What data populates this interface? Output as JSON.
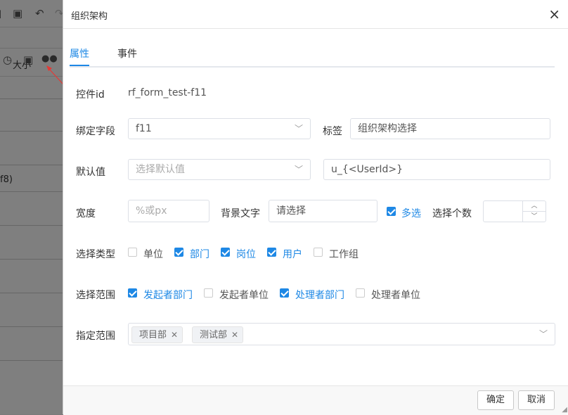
{
  "background": {
    "size_label": "大小",
    "field_ref": "f8)"
  },
  "dialog": {
    "title": "组织架构",
    "close_symbol": "×",
    "tabs": [
      {
        "label": "属性",
        "active": true
      },
      {
        "label": "事件",
        "active": false
      }
    ],
    "control_id": {
      "label": "控件id",
      "value": "rf_form_test-f11"
    },
    "bind_field": {
      "label": "绑定字段",
      "value": "f11"
    },
    "tag_label": {
      "label": "标签",
      "value": "组织架构选择"
    },
    "default_value": {
      "label": "默认值",
      "placeholder": "选择默认值",
      "expression": "u_{<UserId>}"
    },
    "width": {
      "label": "宽度",
      "placeholder": "%或px"
    },
    "bg_text": {
      "label": "背景文字",
      "value": "请选择"
    },
    "multi_select": {
      "label": "多选",
      "checked": true
    },
    "select_count": {
      "label": "选择个数",
      "value": ""
    },
    "select_type": {
      "label": "选择类型",
      "options": [
        {
          "label": "单位",
          "checked": false
        },
        {
          "label": "部门",
          "checked": true
        },
        {
          "label": "岗位",
          "checked": true
        },
        {
          "label": "用户",
          "checked": true
        },
        {
          "label": "工作组",
          "checked": false
        }
      ]
    },
    "select_range": {
      "label": "选择范围",
      "options": [
        {
          "label": "发起者部门",
          "checked": true
        },
        {
          "label": "发起者单位",
          "checked": false
        },
        {
          "label": "处理者部门",
          "checked": true
        },
        {
          "label": "处理者单位",
          "checked": false
        }
      ]
    },
    "specified_range": {
      "label": "指定范围",
      "tags": [
        "项目部",
        "测试部"
      ]
    },
    "buttons": {
      "ok": "确定",
      "cancel": "取消"
    }
  },
  "colors": {
    "accent": "#1e88e5",
    "overlay": "rgba(0,0,0,0.5)"
  }
}
